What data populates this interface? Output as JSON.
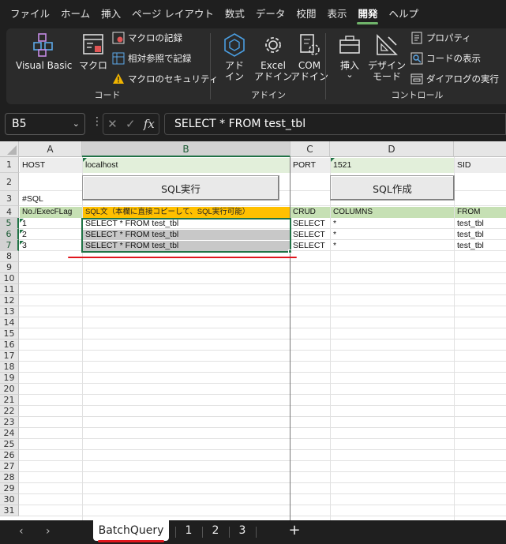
{
  "menu": [
    "ファイル",
    "ホーム",
    "挿入",
    "ページ レイアウト",
    "数式",
    "データ",
    "校閲",
    "表示",
    "開発",
    "ヘルプ"
  ],
  "menu_active_index": 8,
  "ribbon": {
    "code": {
      "label": "コード",
      "visual_basic": "Visual Basic",
      "macro": "マクロ",
      "record_macro": "マクロの記録",
      "relative_ref": "相対参照で記録",
      "macro_security": "マクロのセキュリティ"
    },
    "addins": {
      "label": "アドイン",
      "addin_line1": "アド",
      "addin_line2": "イン",
      "excel_addin_line1": "Excel",
      "excel_addin_line2": "アドイン",
      "com_addin_line1": "COM",
      "com_addin_line2": "アドイン"
    },
    "controls": {
      "label": "コントロール",
      "insert": "挿入",
      "insert_arrow": "⌄",
      "design_mode_line1": "デザイン",
      "design_mode_line2": "モード",
      "properties": "プロパティ",
      "view_code": "コードの表示",
      "run_dialog": "ダイアログの実行"
    }
  },
  "formula_bar": {
    "name_box": "B5",
    "formula": "SELECT * FROM test_tbl"
  },
  "columns": [
    "A",
    "B",
    "C",
    "D"
  ],
  "rows": [
    "1",
    "2",
    "3",
    "4",
    "5",
    "6",
    "7",
    "8",
    "9",
    "10",
    "11",
    "12",
    "13",
    "14",
    "15",
    "16",
    "17",
    "18",
    "19",
    "20",
    "21",
    "22",
    "23",
    "24",
    "25",
    "26",
    "27",
    "28",
    "29",
    "30",
    "31"
  ],
  "cells": {
    "a1": "HOST",
    "b1": "localhost",
    "c1": "PORT",
    "d1": "1521",
    "e1": "SID",
    "a3": "#SQL",
    "a4": "No./ExecFLag",
    "b4": "SQL文（本欄に直接コピーして、SQL実行可能）",
    "c4": "CRUD",
    "d4": "COLUMNS",
    "e4": "FROM",
    "data_rows": [
      {
        "no": "1",
        "sql": "SELECT * FROM test_tbl",
        "crud": "SELECT",
        "columns": "*",
        "from": "test_tbl"
      },
      {
        "no": "2",
        "sql": "SELECT * FROM test_tbl",
        "crud": "SELECT",
        "columns": "*",
        "from": "test_tbl"
      },
      {
        "no": "3",
        "sql": "SELECT * FROM test_tbl",
        "crud": "SELECT",
        "columns": "*",
        "from": "test_tbl"
      }
    ]
  },
  "buttons": {
    "run_sql": "SQL実行",
    "make_sql": "SQL作成"
  },
  "sheets": {
    "tabs": [
      "BatchQuery",
      "1",
      "2",
      "3"
    ],
    "active": "BatchQuery",
    "add": "+"
  },
  "colors": {
    "accent_green": "#217346",
    "annotation_red": "#e0161d",
    "header_orange": "#ffc000"
  }
}
